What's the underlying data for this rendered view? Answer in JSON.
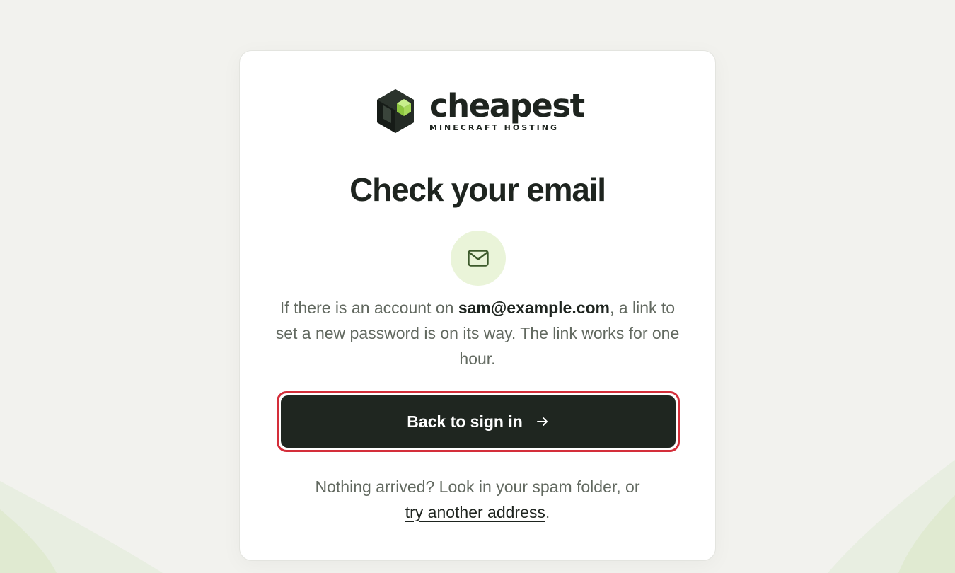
{
  "brand": {
    "name": "cheapest",
    "tagline": "MINECRAFT HOSTING",
    "colors": {
      "dark": "#1e241f",
      "accent": "#9bd24a"
    }
  },
  "page": {
    "title": "Check your email",
    "icon": "mail-icon",
    "message": {
      "prefix": "If there is an account on ",
      "email": "sam@example.com",
      "suffix": ", a link to set a new password is on its way. The link works for one hour."
    },
    "primary_button": {
      "label": "Back to sign in",
      "icon": "arrow-right-icon"
    },
    "footer": {
      "text": "Nothing arrived? Look in your spam folder, or",
      "link_label": "try another address",
      "trailing": "."
    }
  }
}
